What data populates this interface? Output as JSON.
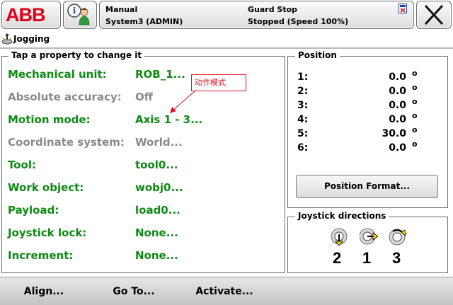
{
  "header": {
    "logo_text": "ABB",
    "status": {
      "mode": "Manual",
      "system": "System3 (ADMIN)",
      "safety": "Guard Stop",
      "state": "Stopped (Speed 100%)"
    },
    "icons": [
      "abb-logo",
      "user-icon",
      "status-indicator-icon",
      "close-icon"
    ]
  },
  "title": "Jogging",
  "properties": {
    "legend": "Tap a property to change it",
    "rows": [
      {
        "label": "Mechanical unit:",
        "value": "ROB_1...",
        "enabled": true
      },
      {
        "label": "Absolute accuracy:",
        "value": "Off",
        "enabled": false
      },
      {
        "label": "Motion mode:",
        "value": "Axis 1 - 3...",
        "enabled": true
      },
      {
        "label": "Coordinate system:",
        "value": "World...",
        "enabled": false
      },
      {
        "label": "Tool:",
        "value": "tool0...",
        "enabled": true
      },
      {
        "label": "Work object:",
        "value": "wobj0...",
        "enabled": true
      },
      {
        "label": "Payload:",
        "value": "load0...",
        "enabled": true
      },
      {
        "label": "Joystick lock:",
        "value": "None...",
        "enabled": true
      },
      {
        "label": "Increment:",
        "value": "None...",
        "enabled": true
      }
    ]
  },
  "annotation": {
    "text": "动作模式",
    "color": "#d8142a"
  },
  "position": {
    "legend": "Position",
    "rows": [
      {
        "index": "1:",
        "value": "0.0",
        "unit": "o"
      },
      {
        "index": "2:",
        "value": "0.0",
        "unit": "o"
      },
      {
        "index": "3:",
        "value": "0.0",
        "unit": "o"
      },
      {
        "index": "4:",
        "value": "0.0",
        "unit": "o"
      },
      {
        "index": "5:",
        "value": "30.0",
        "unit": "o"
      },
      {
        "index": "6:",
        "value": "0.0",
        "unit": "o"
      }
    ],
    "format_button": "Position Format..."
  },
  "joystick": {
    "legend": "Joystick directions",
    "axes": [
      "2",
      "1",
      "3"
    ]
  },
  "bottom": {
    "align": "Align...",
    "goto": "Go To...",
    "activate": "Activate..."
  },
  "colors": {
    "enabled": "#0f8a14",
    "disabled": "#8a8a8a",
    "brand": "#e0001a"
  }
}
